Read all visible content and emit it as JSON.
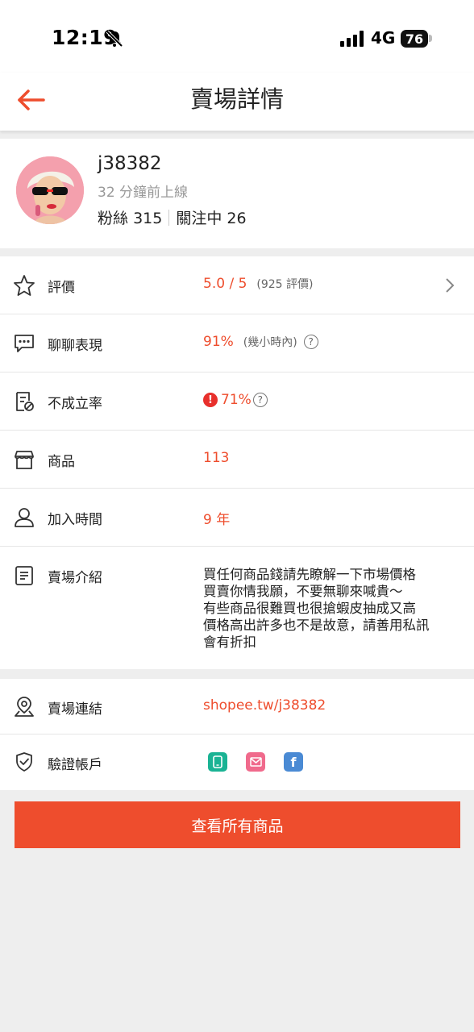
{
  "status_bar": {
    "time": "12:19",
    "network": "4G",
    "battery": "76"
  },
  "header": {
    "title": "賣場詳情"
  },
  "profile": {
    "username": "j38382",
    "last_active": "32 分鐘前上線",
    "followers_label": "粉絲",
    "followers_count": "315",
    "following_label": "關注中",
    "following_count": "26"
  },
  "rows": {
    "rating": {
      "label": "評價",
      "value": "5.0 / 5",
      "note": "(925 評價)"
    },
    "chat": {
      "label": "聊聊表現",
      "value": "91%",
      "note": "(幾小時內)"
    },
    "cancel": {
      "label": "不成立率",
      "value": "71%"
    },
    "products": {
      "label": "商品",
      "value": "113"
    },
    "joined": {
      "label": "加入時間",
      "value": "9 年"
    },
    "intro": {
      "label": "賣場介紹",
      "value": "買任何商品錢請先瞭解一下市場價格\n買賣你情我願，不要無聊來喊貴～\n有些商品很難買也很搶蝦皮抽成又高\n價格高出許多也不是故意，請善用私訊\n會有折扣"
    },
    "link": {
      "label": "賣場連結",
      "value": "shopee.tw/j38382"
    },
    "verified": {
      "label": "驗證帳戶",
      "facebook_letter": "f"
    }
  },
  "cta": {
    "label": "查看所有商品"
  },
  "colors": {
    "accent": "#ee4d2d",
    "phone_badge": "#1ab394",
    "email_badge": "#f06a8c",
    "facebook_badge": "#4a8ad4"
  }
}
